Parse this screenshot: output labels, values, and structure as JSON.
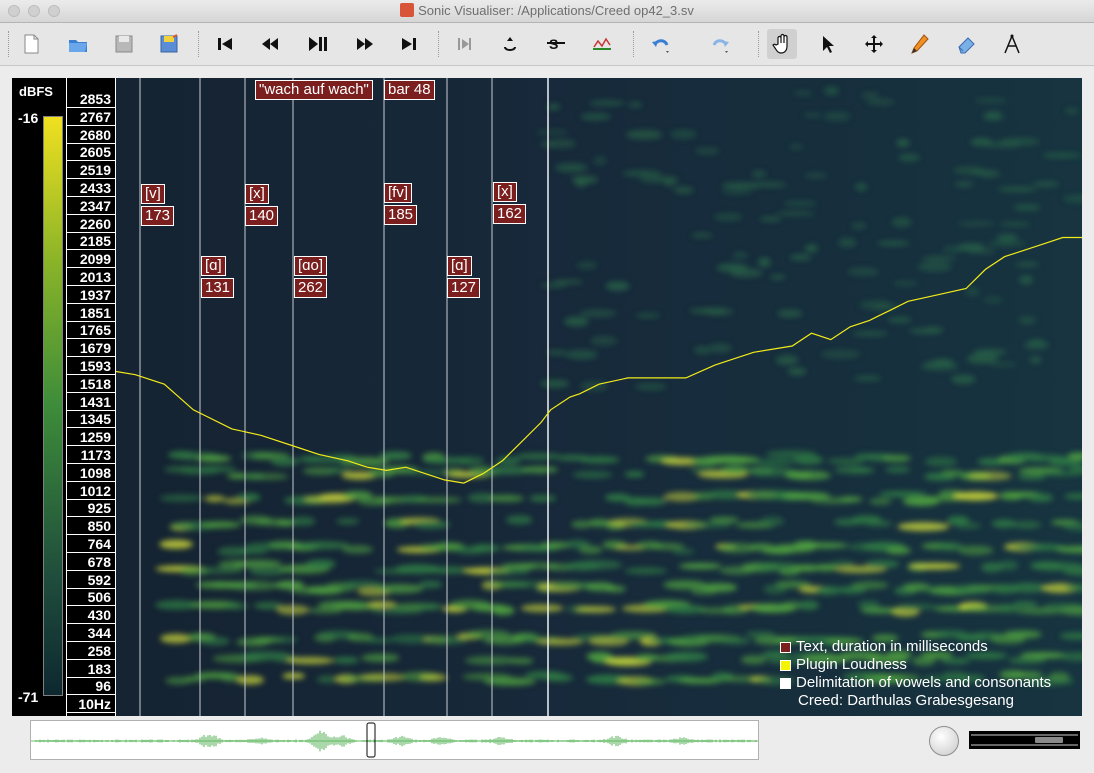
{
  "window": {
    "title": "Sonic Visualiser: /Applications/Creed op42_3.sv"
  },
  "toolbar": {
    "icons": [
      "new-file-icon",
      "open-folder-icon",
      "save-icon",
      "save-session-icon",
      "rewind-start-icon",
      "rewind-icon",
      "play-pause-icon",
      "fast-forward-icon",
      "fast-forward-end-icon",
      "play-selection-icon",
      "loop-icon",
      "solo-icon",
      "follow-playback-icon",
      "undo-icon",
      "redo-icon",
      "navigate-hand-icon",
      "select-arrow-icon",
      "move-icon",
      "draw-pencil-icon",
      "erase-icon",
      "measure-icon"
    ]
  },
  "pane": {
    "scale_unit": "dBFS",
    "scale_max": "-16",
    "scale_min": "-71",
    "frequencies": [
      "2853",
      "2767",
      "2680",
      "2605",
      "2519",
      "2433",
      "2347",
      "2260",
      "2185",
      "2099",
      "2013",
      "1937",
      "1851",
      "1765",
      "1679",
      "1593",
      "1518",
      "1431",
      "1345",
      "1259",
      "1173",
      "1098",
      "1012",
      "925",
      "850",
      "764",
      "678",
      "592",
      "506",
      "430",
      "344",
      "258",
      "183",
      "96",
      "10Hz"
    ],
    "segments": [
      {
        "label": "[v]",
        "ms": "173"
      },
      {
        "label": "[ɑ]",
        "ms": "131"
      },
      {
        "label": "[x]",
        "ms": "140"
      },
      {
        "label": "[ɑo]",
        "ms": "262"
      },
      {
        "label": "[fv]",
        "ms": "185"
      },
      {
        "label": "[ɑ]",
        "ms": "127"
      },
      {
        "label": "[x]",
        "ms": "162"
      }
    ],
    "text_label": "\"wach auf wach\"",
    "bar_label": "bar 48",
    "loudness": [
      [
        0.0,
        46
      ],
      [
        0.02,
        46.5
      ],
      [
        0.05,
        48
      ],
      [
        0.08,
        52
      ],
      [
        0.12,
        55
      ],
      [
        0.15,
        56
      ],
      [
        0.19,
        58
      ],
      [
        0.21,
        59
      ],
      [
        0.24,
        60
      ],
      [
        0.26,
        61
      ],
      [
        0.28,
        61.5
      ],
      [
        0.3,
        61
      ],
      [
        0.32,
        62
      ],
      [
        0.34,
        63
      ],
      [
        0.36,
        63.5
      ],
      [
        0.38,
        62
      ],
      [
        0.4,
        60
      ],
      [
        0.42,
        57
      ],
      [
        0.44,
        54
      ],
      [
        0.45,
        52
      ],
      [
        0.46,
        51
      ],
      [
        0.47,
        50
      ],
      [
        0.48,
        49.5
      ],
      [
        0.5,
        48
      ],
      [
        0.53,
        47
      ],
      [
        0.56,
        47
      ],
      [
        0.59,
        47
      ],
      [
        0.62,
        45
      ],
      [
        0.64,
        44
      ],
      [
        0.66,
        43
      ],
      [
        0.68,
        42.5
      ],
      [
        0.7,
        42
      ],
      [
        0.72,
        40
      ],
      [
        0.74,
        41
      ],
      [
        0.76,
        39
      ],
      [
        0.78,
        38
      ],
      [
        0.8,
        36.5
      ],
      [
        0.82,
        35
      ],
      [
        0.85,
        34
      ],
      [
        0.88,
        33
      ],
      [
        0.9,
        30
      ],
      [
        0.92,
        28
      ],
      [
        0.94,
        27
      ],
      [
        0.96,
        26
      ],
      [
        0.98,
        25
      ],
      [
        1.0,
        25
      ]
    ],
    "legend": {
      "items": [
        {
          "label": "Text, duration in milliseconds",
          "color": "#7a1e1e"
        },
        {
          "label": "Plugin Loudness",
          "color": "#f4f400"
        },
        {
          "label": "Delimitation of vowels and consonants",
          "color": "#ffffff"
        }
      ],
      "note": "Creed: Darthulas Grabesgesang"
    }
  }
}
